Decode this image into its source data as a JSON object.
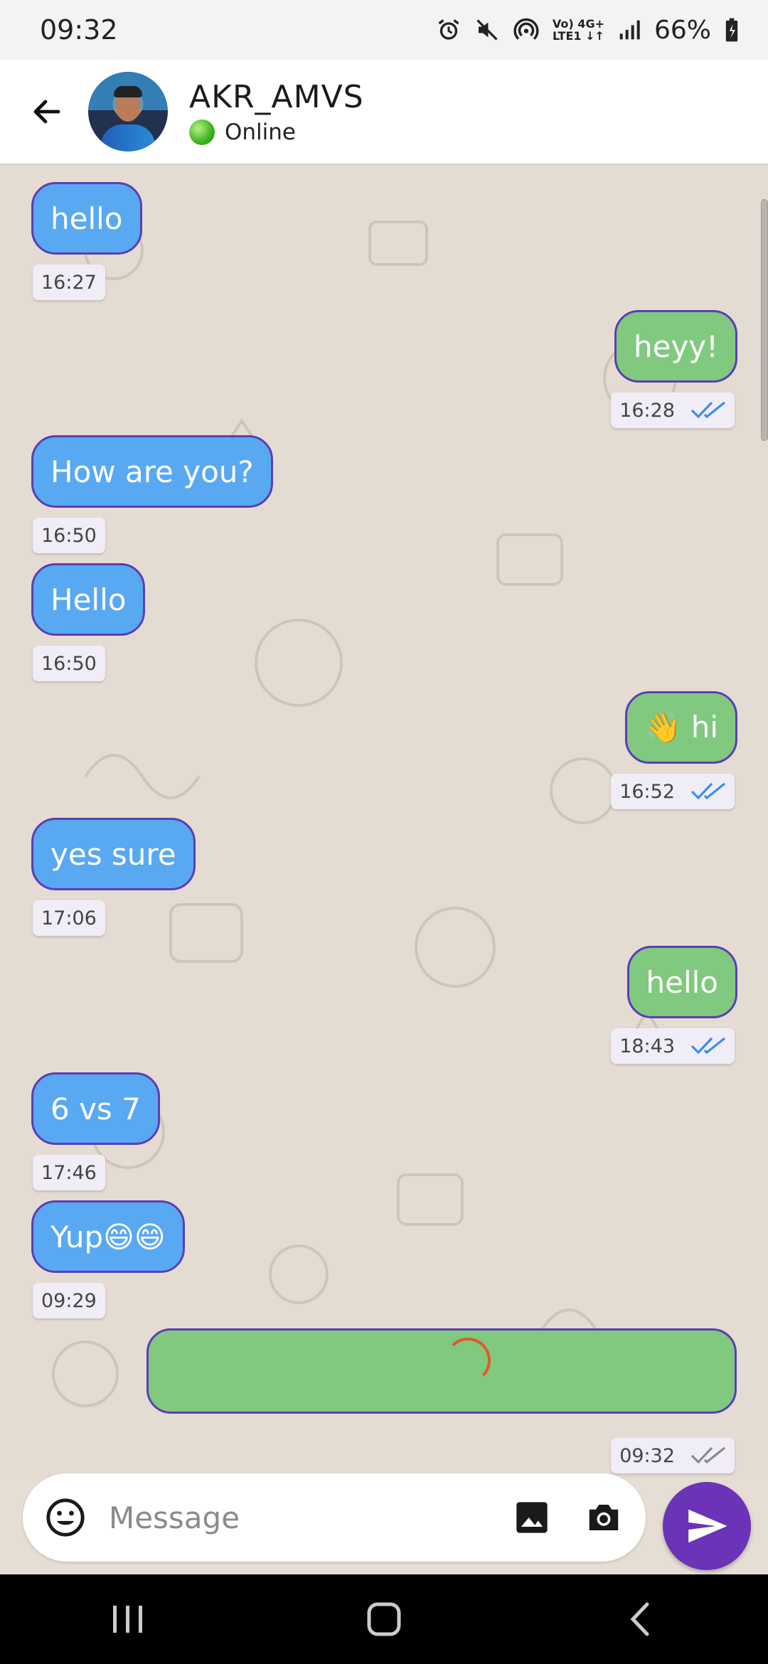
{
  "status_bar": {
    "time": "09:32",
    "network_top": "Vo) 4G+",
    "network_bottom": "LTE1 ↓↑",
    "battery": "66%"
  },
  "header": {
    "contact_name": "AKR_AMVS",
    "status": "Online",
    "status_color": "#3cb21d"
  },
  "messages": [
    {
      "dir": "in",
      "text": "hello",
      "time": "16:27"
    },
    {
      "dir": "out",
      "text": "heyy!",
      "time": "16:28",
      "ticks": "read"
    },
    {
      "dir": "in",
      "text": "How are you?",
      "time": "16:50"
    },
    {
      "dir": "in",
      "text": "Hello",
      "time": "16:50"
    },
    {
      "dir": "out",
      "text": "👋 hi",
      "time": "16:52",
      "ticks": "read"
    },
    {
      "dir": "in",
      "text": "yes sure",
      "time": "17:06"
    },
    {
      "dir": "out",
      "text": "hello",
      "time": "18:43",
      "ticks": "read"
    },
    {
      "dir": "in",
      "text": "6 vs 7",
      "time": "17:46"
    },
    {
      "dir": "in",
      "text": "Yup😄😄",
      "time": "09:29"
    },
    {
      "dir": "out",
      "text": "",
      "time": "09:32",
      "ticks": "sent",
      "loading": true
    }
  ],
  "input": {
    "placeholder": "Message"
  },
  "icons": {
    "back": "arrow-left-icon",
    "emoji": "smiley-icon",
    "gallery": "image-icon",
    "camera": "camera-icon",
    "send": "send-icon"
  },
  "colors": {
    "incoming_bubble": "#59a8f2",
    "outgoing_bubble": "#80c97f",
    "bubble_border": "#5b3fb3",
    "send_button": "#6a33b8",
    "read_ticks": "#3b8ee6",
    "sent_ticks": "#8a8a8a"
  }
}
